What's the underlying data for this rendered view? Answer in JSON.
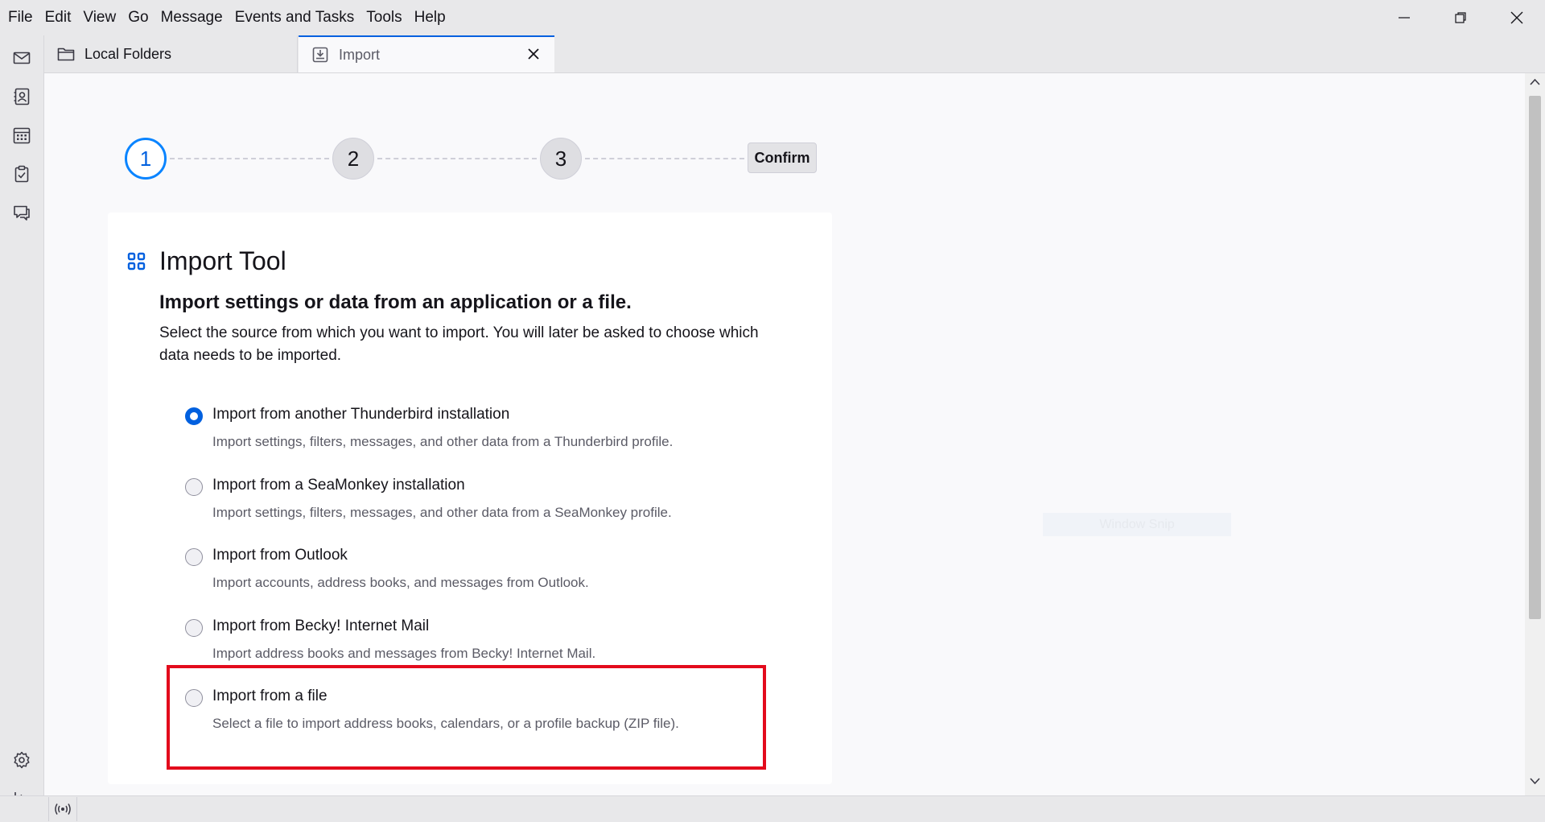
{
  "menu": [
    "File",
    "Edit",
    "View",
    "Go",
    "Message",
    "Events and Tasks",
    "Tools",
    "Help"
  ],
  "window_controls": [
    "minimize-icon",
    "restore-icon",
    "close-icon"
  ],
  "tabs": [
    {
      "label": "Local Folders",
      "icon": "folder-icon"
    },
    {
      "label": "Import",
      "icon": "import-icon",
      "active": true
    }
  ],
  "spaces": [
    "mail-icon",
    "address-book-icon",
    "calendar-icon",
    "tasks-icon",
    "chat-icon"
  ],
  "spaces_bottom": [
    "settings-icon",
    "collapse-icon"
  ],
  "status": {
    "icon": "online-status-icon"
  },
  "steps": [
    "1",
    "2",
    "3"
  ],
  "confirm_label": "Confirm",
  "tool_title": "Import Tool",
  "subtitle": "Import settings or data from an application or a file.",
  "description": "Select the source from which you want to import. You will later be asked to choose which data needs to be imported.",
  "options": [
    {
      "label": "Import from another Thunderbird installation",
      "desc": "Import settings, filters, messages, and other data from a Thunderbird profile.",
      "checked": true
    },
    {
      "label": "Import from a SeaMonkey installation",
      "desc": "Import settings, filters, messages, and other data from a SeaMonkey profile.",
      "checked": false
    },
    {
      "label": "Import from Outlook",
      "desc": "Import accounts, address books, and messages from Outlook.",
      "checked": false
    },
    {
      "label": "Import from Becky! Internet Mail",
      "desc": "Import address books and messages from Becky! Internet Mail.",
      "checked": false
    },
    {
      "label": "Import from a file",
      "desc": "Select a file to import address books, calendars, or a profile backup (ZIP file).",
      "checked": false
    }
  ],
  "overlay_text": "Window Snip",
  "colors": {
    "accent": "#0060df",
    "highlight": "#e30b1c"
  }
}
